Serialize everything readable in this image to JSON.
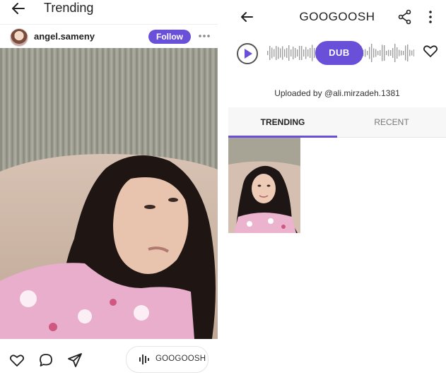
{
  "left": {
    "header": {
      "title": "Trending",
      "back_icon": "arrow-left-icon"
    },
    "post": {
      "username": "angel.sameny",
      "follow_label": "Follow",
      "more_icon": "more-horizontal-icon"
    },
    "actions": {
      "like_icon": "heart-outline-icon",
      "comment_icon": "comment-bubble-icon",
      "share_icon": "send-plane-icon",
      "sound_label": "GOOGOOSH",
      "sound_icon": "waveform-icon"
    }
  },
  "right": {
    "header": {
      "title": "GOOGOOSH",
      "back_icon": "arrow-left-icon",
      "share_icon": "share-nodes-icon",
      "menu_icon": "more-vertical-icon"
    },
    "player": {
      "play_icon": "play-circle-icon",
      "dub_label": "DUB",
      "favorite_icon": "heart-outline-icon"
    },
    "uploaded_by": "Uploaded by @ali.mirzadeh.1381",
    "tabs": [
      {
        "label": "TRENDING",
        "active": true
      },
      {
        "label": "RECENT",
        "active": false
      }
    ]
  },
  "colors": {
    "accent": "#6a4fd8",
    "text": "#212121",
    "tab_bg": "#f7f7f7"
  }
}
